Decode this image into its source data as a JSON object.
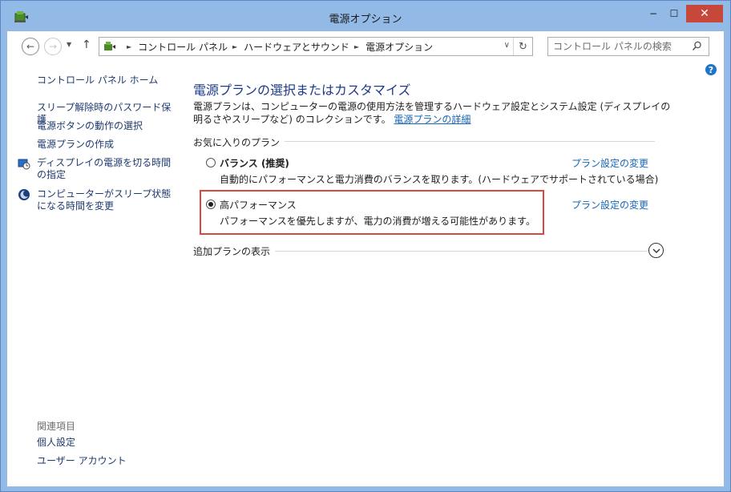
{
  "window": {
    "title": "電源オプション",
    "minimize": "−",
    "maximize": "☐",
    "close": "✕"
  },
  "navbar": {
    "back_glyph": "←",
    "forward_glyph": "→",
    "dropdown_glyph": "▼",
    "up_glyph": "↑",
    "breadcrumb": [
      "コントロール パネル",
      "ハードウェアとサウンド",
      "電源オプション"
    ],
    "breadcrumb_sep": "►",
    "address_dropdown_glyph": "∨",
    "refresh_glyph": "↻",
    "search_placeholder": "コントロール パネルの検索"
  },
  "help": {
    "glyph": "?"
  },
  "sidebar": {
    "home": "コントロール パネル ホーム",
    "links": [
      "スリープ解除時のパスワード保護",
      "電源ボタンの動作の選択",
      "電源プランの作成",
      "ディスプレイの電源を切る時間の指定",
      "コンピューターがスリープ状態になる時間を変更"
    ],
    "related_heading": "関連項目",
    "related": [
      "個人設定",
      "ユーザー アカウント"
    ]
  },
  "main": {
    "title": "電源プランの選択またはカスタマイズ",
    "description": "電源プランは、コンピューターの電源の使用方法を管理するハードウェア設定とシステム設定 (ディスプレイの明るさやスリープなど) のコレクションです。",
    "description_link": "電源プランの詳細",
    "favorites_label": "お気に入りのプラン",
    "plans": [
      {
        "name": "バランス (推奨)",
        "description": "自動的にパフォーマンスと電力消費のバランスを取ります。(ハードウェアでサポートされている場合)",
        "link": "プラン設定の変更",
        "selected": false
      },
      {
        "name": "高パフォーマンス",
        "description": "パフォーマンスを優先しますが、電力の消費が増える可能性があります。",
        "link": "プラン設定の変更",
        "selected": true
      }
    ],
    "more_plans_label": "追加プランの表示",
    "more_toggle_glyph": "⌄"
  },
  "colors": {
    "title_bar": "#93b9e6",
    "close_button": "#c7473a",
    "link": "#1566b8",
    "heading": "#1e3a8a",
    "highlight_border": "#d9473d"
  }
}
